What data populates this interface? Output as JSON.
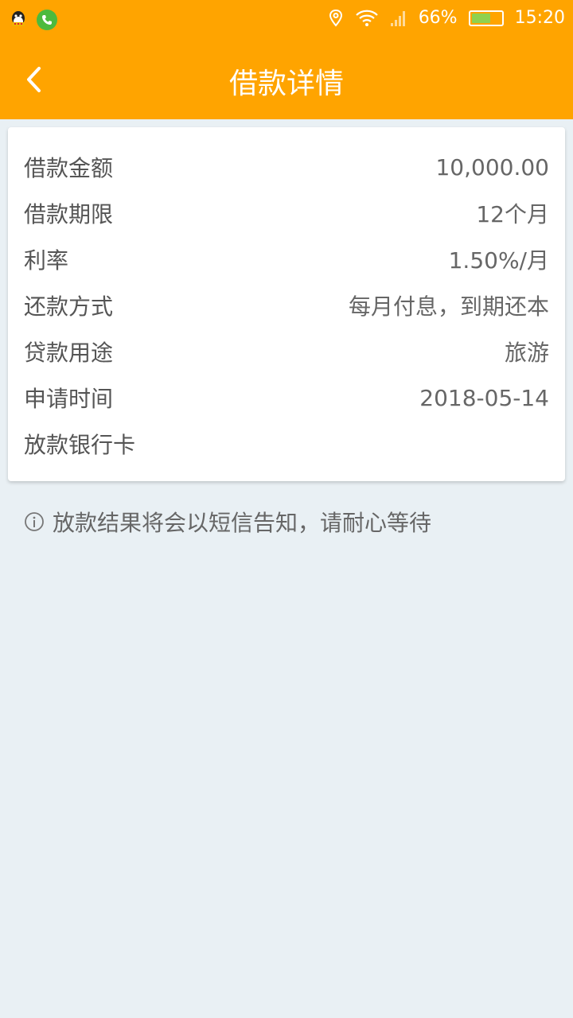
{
  "status_bar": {
    "battery_percent": "66%",
    "battery_level": 0.66,
    "time": "15:20",
    "icons": [
      "qq-icon",
      "phone-icon",
      "location-icon",
      "wifi-icon",
      "signal-icon",
      "battery-icon"
    ]
  },
  "header": {
    "title": "借款详情",
    "back_icon": "chevron-left-icon",
    "background": "#ffa400"
  },
  "details": [
    {
      "label": "借款金额",
      "value": "10,000.00"
    },
    {
      "label": "借款期限",
      "value": "12个月"
    },
    {
      "label": "利率",
      "value": "1.50%/月"
    },
    {
      "label": "还款方式",
      "value": "每月付息，到期还本"
    },
    {
      "label": "贷款用途",
      "value": "旅游"
    },
    {
      "label": "申请时间",
      "value": "2018-05-14"
    },
    {
      "label": "放款银行卡",
      "value": ""
    }
  ],
  "notice": {
    "icon": "info-icon",
    "text": "放款结果将会以短信告知，请耐心等待"
  }
}
